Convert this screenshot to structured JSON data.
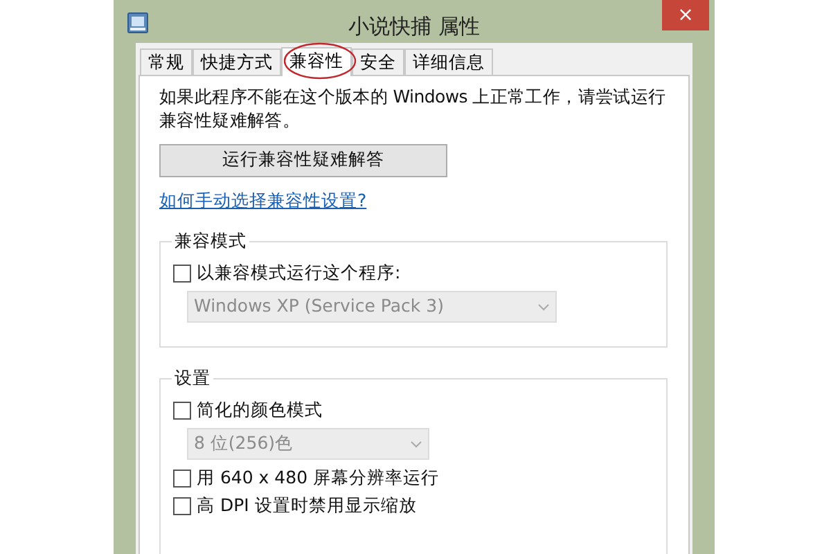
{
  "window": {
    "title": "小说快捕 属性",
    "close": "×"
  },
  "tabs": [
    {
      "label": "常规",
      "selected": false
    },
    {
      "label": "快捷方式",
      "selected": false
    },
    {
      "label": "兼容性",
      "selected": true
    },
    {
      "label": "安全",
      "selected": false
    },
    {
      "label": "详细信息",
      "selected": false
    }
  ],
  "intro": "如果此程序不能在这个版本的 Windows 上正常工作，请尝试运行兼容性疑难解答。",
  "troubleshoot_button": "运行兼容性疑难解答",
  "help_link": "如何手动选择兼容性设置?",
  "groups": [
    {
      "title": "兼容模式",
      "items": [
        {
          "kind": "checkbox",
          "label": "以兼容模式运行这个程序:",
          "checked": false
        },
        {
          "kind": "dropdown",
          "value": "Windows XP (Service Pack 3)",
          "disabled": true,
          "wide": true
        }
      ]
    },
    {
      "title": "设置",
      "items": [
        {
          "kind": "checkbox",
          "label": "简化的颜色模式",
          "checked": false
        },
        {
          "kind": "dropdown",
          "value": "8 位(256)色",
          "disabled": true,
          "wide": false
        },
        {
          "kind": "checkbox",
          "label": "用 640 x 480 屏幕分辨率运行",
          "checked": false
        },
        {
          "kind": "checkbox",
          "label": "高 DPI 设置时禁用显示缩放",
          "checked": false
        }
      ]
    }
  ]
}
